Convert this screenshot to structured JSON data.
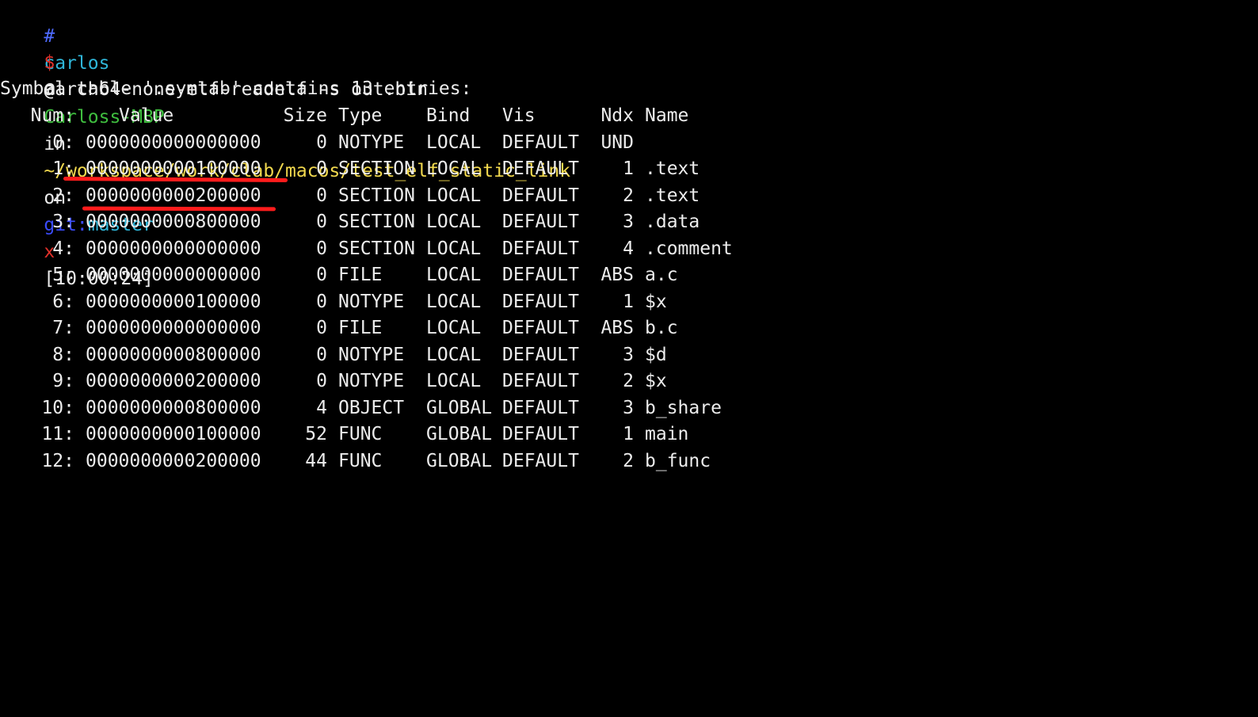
{
  "prompt": {
    "hash": "#",
    "user": "carlos",
    "at": "@",
    "host": "Carloss-MBP",
    "in_label": "in",
    "path": "~/workspace/work/clab/macos/test_elf_static_link",
    "on_label": "on",
    "git_label": "git:",
    "branch": "master",
    "dirty_marker": "x",
    "time": "[10:00:24]"
  },
  "command": {
    "symbol": "$",
    "text": "aarch64-none-elf-readelf -s out.bin"
  },
  "output": {
    "summary": "Symbol table '.symtab' contains 13 entries:",
    "headers": {
      "num": "Num:",
      "value": "Value",
      "size": "Size",
      "type": "Type",
      "bind": "Bind",
      "vis": "Vis",
      "ndx": "Ndx",
      "name": "Name"
    },
    "rows": [
      {
        "num": "0:",
        "value": "0000000000000000",
        "size": "0",
        "type": "NOTYPE",
        "bind": "LOCAL",
        "vis": "DEFAULT",
        "ndx": "UND",
        "name": ""
      },
      {
        "num": "1:",
        "value": "0000000000100000",
        "size": "0",
        "type": "SECTION",
        "bind": "LOCAL",
        "vis": "DEFAULT",
        "ndx": "1",
        "name": ".text"
      },
      {
        "num": "2:",
        "value": "0000000000200000",
        "size": "0",
        "type": "SECTION",
        "bind": "LOCAL",
        "vis": "DEFAULT",
        "ndx": "2",
        "name": ".text"
      },
      {
        "num": "3:",
        "value": "0000000000800000",
        "size": "0",
        "type": "SECTION",
        "bind": "LOCAL",
        "vis": "DEFAULT",
        "ndx": "3",
        "name": ".data"
      },
      {
        "num": "4:",
        "value": "0000000000000000",
        "size": "0",
        "type": "SECTION",
        "bind": "LOCAL",
        "vis": "DEFAULT",
        "ndx": "4",
        "name": ".comment"
      },
      {
        "num": "5:",
        "value": "0000000000000000",
        "size": "0",
        "type": "FILE",
        "bind": "LOCAL",
        "vis": "DEFAULT",
        "ndx": "ABS",
        "name": "a.c"
      },
      {
        "num": "6:",
        "value": "0000000000100000",
        "size": "0",
        "type": "NOTYPE",
        "bind": "LOCAL",
        "vis": "DEFAULT",
        "ndx": "1",
        "name": "$x"
      },
      {
        "num": "7:",
        "value": "0000000000000000",
        "size": "0",
        "type": "FILE",
        "bind": "LOCAL",
        "vis": "DEFAULT",
        "ndx": "ABS",
        "name": "b.c"
      },
      {
        "num": "8:",
        "value": "0000000000800000",
        "size": "0",
        "type": "NOTYPE",
        "bind": "LOCAL",
        "vis": "DEFAULT",
        "ndx": "3",
        "name": "$d"
      },
      {
        "num": "9:",
        "value": "0000000000200000",
        "size": "0",
        "type": "NOTYPE",
        "bind": "LOCAL",
        "vis": "DEFAULT",
        "ndx": "2",
        "name": "$x"
      },
      {
        "num": "10:",
        "value": "0000000000800000",
        "size": "4",
        "type": "OBJECT",
        "bind": "GLOBAL",
        "vis": "DEFAULT",
        "ndx": "3",
        "name": "b_share"
      },
      {
        "num": "11:",
        "value": "0000000000100000",
        "size": "52",
        "type": "FUNC",
        "bind": "GLOBAL",
        "vis": "DEFAULT",
        "ndx": "1",
        "name": "main"
      },
      {
        "num": "12:",
        "value": "0000000000200000",
        "size": "44",
        "type": "FUNC",
        "bind": "GLOBAL",
        "vis": "DEFAULT",
        "ndx": "2",
        "name": "b_func"
      }
    ]
  },
  "colors": {
    "background": "#000000",
    "foreground": "#ececec",
    "user": "#2fb6d9",
    "host": "#3fbf3f",
    "path": "#f2d94e",
    "git_label": "#3b4cff",
    "dirty": "#e0312a",
    "annotation": "#ff1c1c"
  }
}
